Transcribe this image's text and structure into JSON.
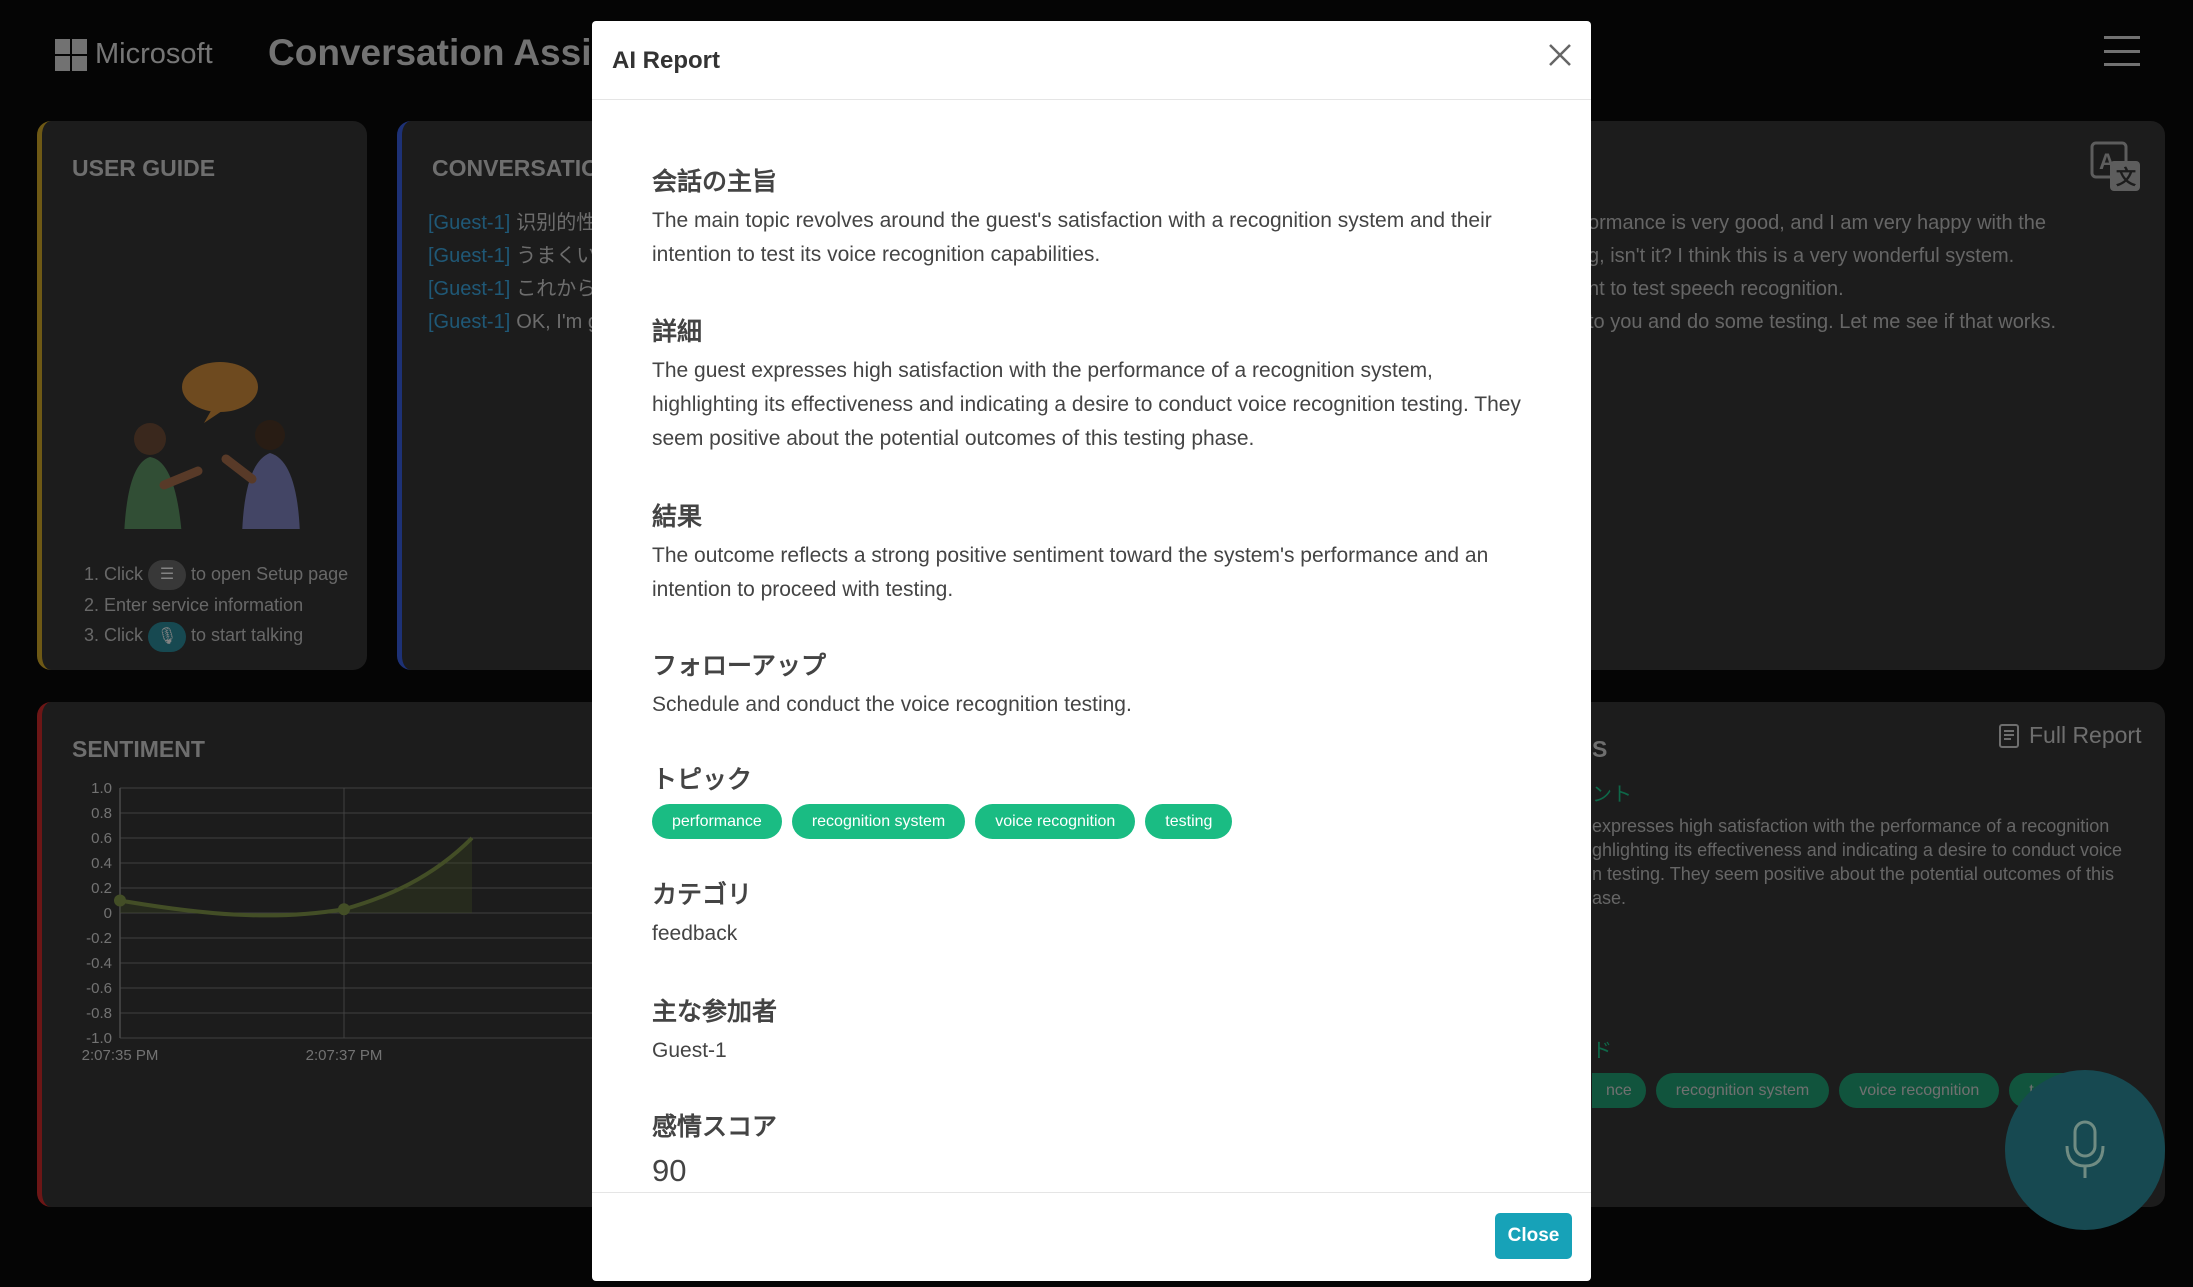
{
  "header": {
    "brand": "Microsoft",
    "app_title": "Conversation Assist Ag"
  },
  "guide": {
    "title": "USER GUIDE",
    "steps": [
      {
        "pre": "Click",
        "post": "to open Setup page",
        "icon": "menu-icon"
      },
      {
        "pre": "Enter service information",
        "post": "",
        "icon": ""
      },
      {
        "pre": "Click",
        "post": "to start talking",
        "icon": "mic-icon"
      }
    ]
  },
  "conversation": {
    "title": "CONVERSATION (",
    "lines": [
      {
        "speaker": "[Guest-1]",
        "text": "识别的性"
      },
      {
        "speaker": "[Guest-1]",
        "text": "うまくい"
      },
      {
        "speaker": "[Guest-1]",
        "text": "これから"
      },
      {
        "speaker": "[Guest-1]",
        "text": "OK, I'm go"
      }
    ],
    "translations": [
      "ormance is very good, and I am very happy with the",
      "",
      "g, isn't it? I think this is a very wonderful system.",
      "nt to test speech recognition.",
      "to you and do some testing. Let me see if that works."
    ]
  },
  "sentiment": {
    "title": "SENTIMENT"
  },
  "chart_data": {
    "type": "line",
    "title": "",
    "x": [
      "2:07:35 PM",
      "2:07:37 PM"
    ],
    "series": [
      {
        "values": [
          0.1,
          0.03,
          0.6
        ]
      }
    ],
    "ylim": [
      -1.0,
      1.0
    ],
    "yticks": [
      "1.0",
      "0.8",
      "0.6",
      "0.4",
      "0.2",
      "0",
      "-0.2",
      "-0.4",
      "-0.6",
      "-0.8",
      "-1.0"
    ],
    "grid": true
  },
  "summary": {
    "heading_partial": "S",
    "full_report_label": "Full Report",
    "sub1": "ント",
    "text_lines": [
      "expresses high satisfaction with the performance of a recognition",
      "ghlighting its effectiveness and indicating a desire to conduct voice",
      "n testing. They seem positive about the potential outcomes of this",
      "ase."
    ],
    "sub2": "ド",
    "tags": [
      "nce",
      "recognition system",
      "voice recognition",
      "testing"
    ]
  },
  "modal": {
    "title": "AI Report",
    "sections": {
      "gist_h": "会話の主旨",
      "gist": "The main topic revolves around the guest's satisfaction with a recognition system and their intention to test its voice recognition capabilities.",
      "detail_h": "詳細",
      "detail": "The guest expresses high satisfaction with the performance of a recognition system, highlighting its effectiveness and indicating a desire to conduct voice recognition testing. They seem positive about the potential outcomes of this testing phase.",
      "result_h": "結果",
      "result": "The outcome reflects a strong positive sentiment toward the system's performance and an intention to proceed with testing.",
      "followup_h": "フォローアップ",
      "followup": "Schedule and conduct the voice recognition testing.",
      "topic_h": "トピック",
      "topics": [
        "performance",
        "recognition system",
        "voice recognition",
        "testing"
      ],
      "category_h": "カテゴリ",
      "category": "feedback",
      "participants_h": "主な参加者",
      "participants": "Guest-1",
      "score_h": "感情スコア",
      "score": "90"
    },
    "close_label": "Close"
  },
  "colors": {
    "guide_accent": "#c9a227",
    "conv_accent": "#3559d8",
    "senti_accent": "#c62828",
    "tag_green": "#1abc83",
    "close_button": "#17a2b8",
    "mic_button": "#2a8594"
  }
}
